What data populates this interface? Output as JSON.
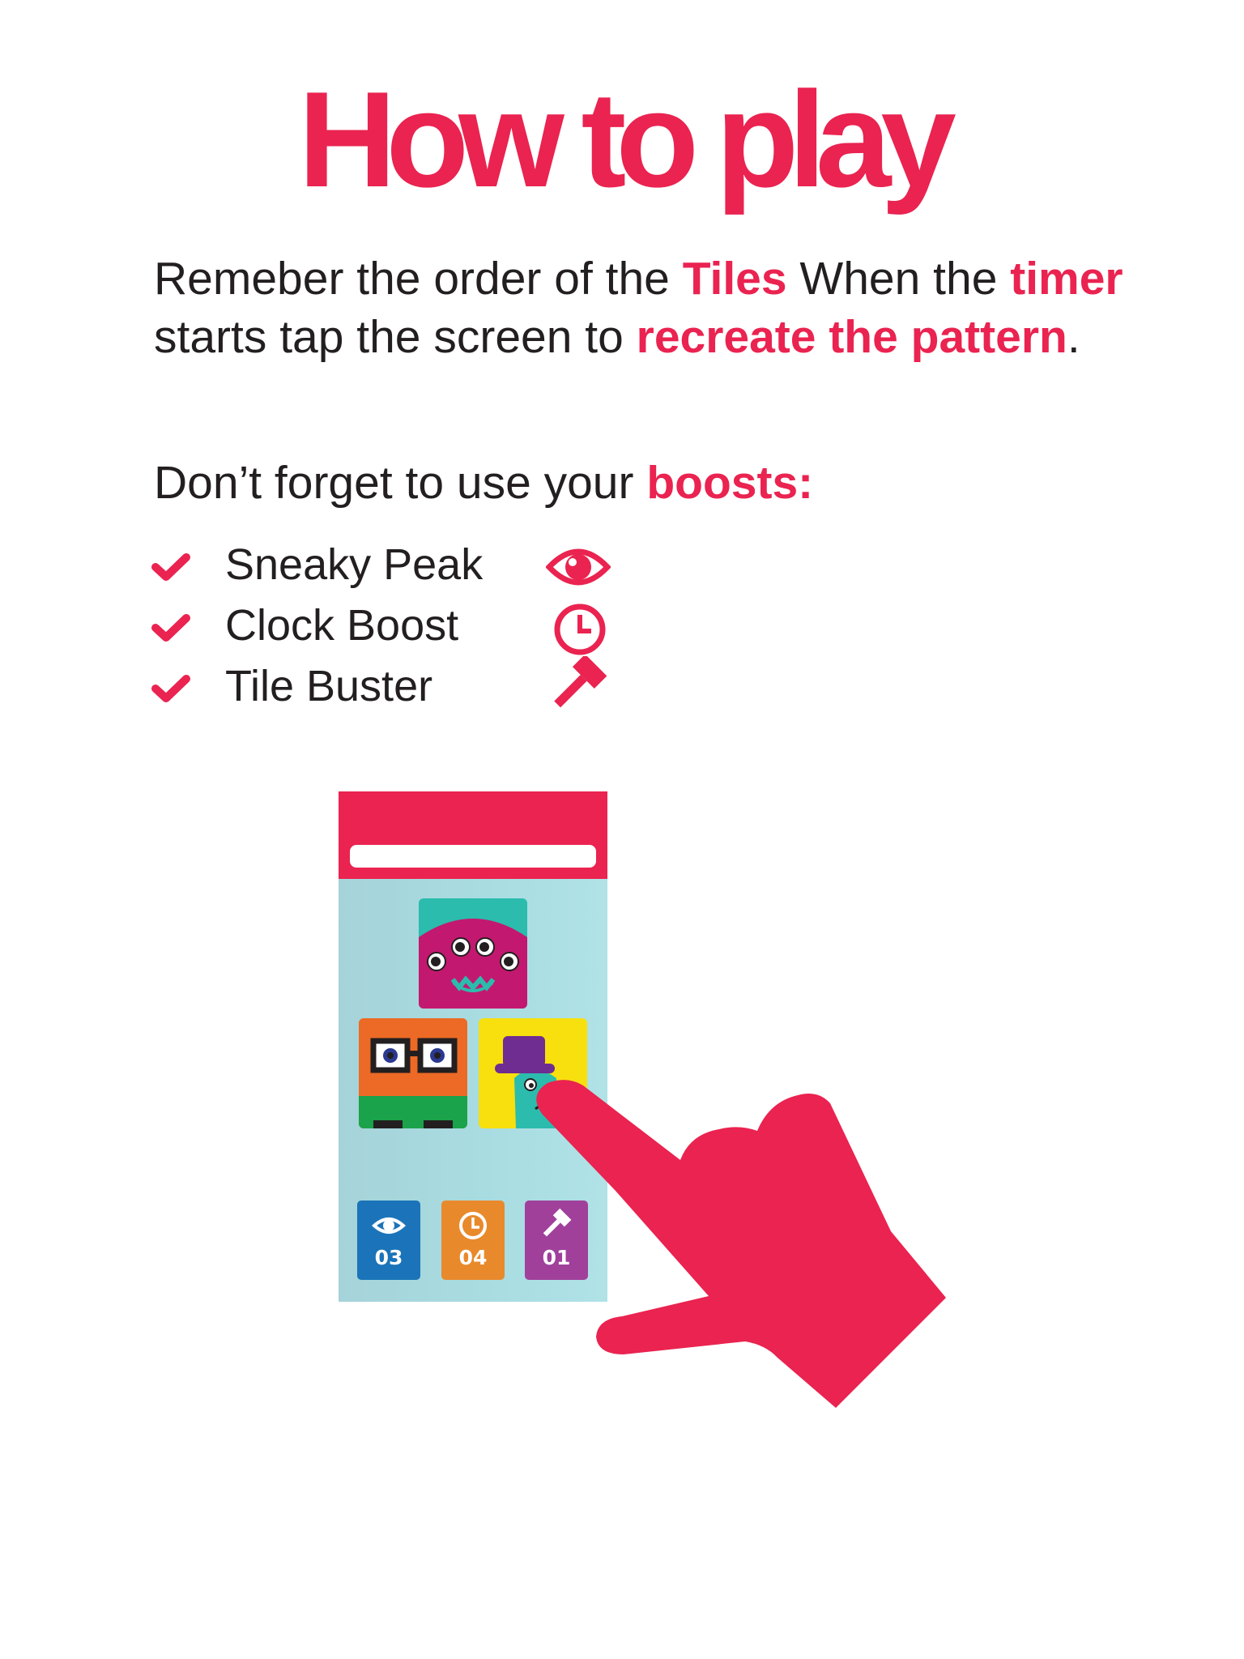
{
  "title": "How to play",
  "intro": {
    "t1": "Remeber the order of the ",
    "tiles": "Tiles",
    "t2": " When the ",
    "timer": "timer",
    "t3": " starts tap the screen to ",
    "recreate": "recreate the pattern",
    "t4": "."
  },
  "boosts_intro": {
    "text": "Don’t forget to use your ",
    "boosts": "boosts:"
  },
  "boosts": [
    {
      "label": "Sneaky Peak",
      "icon": "eye-icon"
    },
    {
      "label": "Clock Boost",
      "icon": "clock-icon"
    },
    {
      "label": "Tile Buster",
      "icon": "hammer-icon"
    }
  ],
  "phone": {
    "boost_buttons": [
      {
        "count": "03",
        "icon": "eye-icon",
        "color": "#1b74b9"
      },
      {
        "count": "04",
        "icon": "clock-icon",
        "color": "#e88a2c"
      },
      {
        "count": "01",
        "icon": "hammer-icon",
        "color": "#a0409b"
      }
    ]
  },
  "colors": {
    "accent": "#ea2350",
    "text": "#231f20"
  }
}
